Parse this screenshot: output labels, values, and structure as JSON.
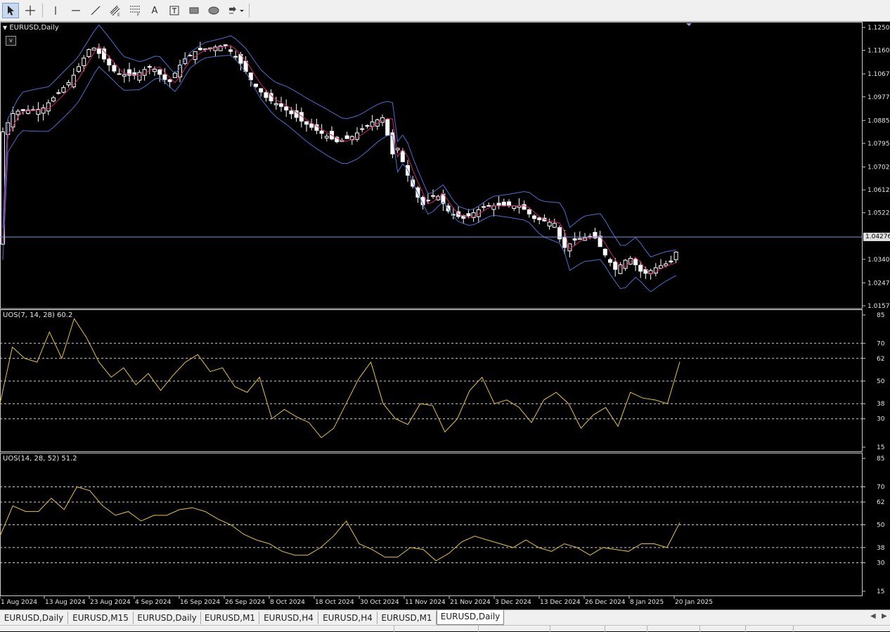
{
  "toolbar": {
    "tools": [
      {
        "icon": "cursor-arrow-icon",
        "active": true
      },
      {
        "icon": "crosshair-icon",
        "active": false
      },
      {
        "icon": "vertical-line-icon",
        "active": false
      },
      {
        "icon": "horizontal-line-icon",
        "active": false
      },
      {
        "icon": "trendline-icon",
        "active": false
      },
      {
        "icon": "equidistant-channel-icon",
        "active": false
      },
      {
        "icon": "fibonacci-retracement-icon",
        "active": false
      },
      {
        "icon": "text-icon",
        "active": false
      },
      {
        "icon": "text-label-icon",
        "active": false
      },
      {
        "icon": "rectangle-icon",
        "active": false
      },
      {
        "icon": "ellipse-icon",
        "active": false
      },
      {
        "icon": "arrow-shapes-dropdown-icon",
        "active": false
      }
    ],
    "text_tool_glyph": "A",
    "text_label_glyph": "T"
  },
  "main_chart": {
    "title": "EURUSD,Daily",
    "sublabel": "v",
    "current_price": "1.04276",
    "price_axis": [
      "1.12500",
      "1.11600",
      "1.10675",
      "1.09775",
      "1.08850",
      "1.07950",
      "1.07025",
      "1.06125",
      "1.05225",
      "1.04276",
      "1.03400",
      "1.02475",
      "1.01575"
    ],
    "colors": {
      "bull": "#ffffff",
      "bear": "#ffffff",
      "bands": "#4a6fd0",
      "mid": "#d0206a",
      "hline": "#7f93d9"
    }
  },
  "indicator1": {
    "title": "UOS(7, 14, 28) 60.2",
    "levels": [
      "85",
      "70",
      "62",
      "50",
      "38",
      "30",
      "15"
    ],
    "color": "#e8c23a"
  },
  "indicator2": {
    "title": "UOS(14, 28, 52) 51.2",
    "levels": [
      "85",
      "70",
      "62",
      "50",
      "38",
      "30",
      "15"
    ],
    "color": "#e8c23a"
  },
  "time_axis": [
    "1 Aug 2024",
    "13 Aug 2024",
    "23 Aug 2024",
    "4 Sep 2024",
    "16 Sep 2024",
    "26 Sep 2024",
    "8 Oct 2024",
    "18 Oct 2024",
    "30 Oct 2024",
    "11 Nov 2024",
    "21 Nov 2024",
    "3 Dec 2024",
    "13 Dec 2024",
    "26 Dec 2024",
    "8 Jan 2025",
    "20 Jan 2025"
  ],
  "chart_data": [
    {
      "type": "candlestick",
      "title": "EURUSD,Daily",
      "ylim": [
        1.01575,
        1.125
      ],
      "x": [
        "1 Aug 2024",
        "13 Aug 2024",
        "23 Aug 2024",
        "4 Sep 2024",
        "16 Sep 2024",
        "26 Sep 2024",
        "8 Oct 2024",
        "18 Oct 2024",
        "30 Oct 2024",
        "11 Nov 2024",
        "21 Nov 2024",
        "3 Dec 2024",
        "13 Dec 2024",
        "26 Dec 2024",
        "8 Jan 2025",
        "20 Jan 2025"
      ],
      "close": [
        1.093,
        1.099,
        1.118,
        1.105,
        1.108,
        1.115,
        1.095,
        1.087,
        1.085,
        1.055,
        1.049,
        1.052,
        1.043,
        1.041,
        1.03,
        1.0428
      ],
      "last_price": 1.04276
    },
    {
      "type": "line",
      "title": "UOS(7, 14, 28) 60.2",
      "ylim": [
        15,
        85
      ],
      "levels": [
        70,
        62,
        50,
        38,
        30
      ],
      "series": [
        {
          "name": "UOS(7, 14, 28)",
          "values": [
            38,
            68,
            62,
            60,
            76,
            62,
            83,
            73,
            60,
            52,
            57,
            48,
            54,
            45,
            53,
            60,
            64,
            55,
            57,
            47,
            44,
            52,
            30,
            35,
            31,
            28,
            20,
            25,
            38,
            51,
            60,
            38,
            30,
            27,
            38,
            37,
            23,
            30,
            45,
            52,
            38,
            40,
            36,
            28,
            40,
            44,
            38,
            25,
            32,
            36,
            26,
            44,
            41,
            40,
            38,
            60.2
          ]
        }
      ],
      "last_value": 60.2
    },
    {
      "type": "line",
      "title": "UOS(14, 28, 52) 51.2",
      "ylim": [
        15,
        85
      ],
      "levels": [
        70,
        62,
        50,
        38,
        30
      ],
      "series": [
        {
          "name": "UOS(14, 28, 52)",
          "values": [
            44,
            60,
            57,
            57,
            64,
            58,
            70,
            68,
            60,
            55,
            57,
            52,
            55,
            55,
            58,
            59,
            57,
            53,
            50,
            45,
            42,
            40,
            36,
            34,
            34,
            38,
            44,
            52,
            40,
            37,
            33,
            33,
            38,
            37,
            31,
            35,
            41,
            44,
            42,
            40,
            38,
            42,
            38,
            36,
            40,
            38,
            34,
            38,
            37,
            36,
            40,
            40,
            38,
            51.2
          ]
        }
      ],
      "last_value": 51.2
    }
  ],
  "tabs": [
    {
      "label": "EURUSD,Daily",
      "active": false
    },
    {
      "label": "EURUSD,M15",
      "active": false
    },
    {
      "label": "EURUSD,Daily",
      "active": false
    },
    {
      "label": "EURUSD,M1",
      "active": false
    },
    {
      "label": "EURUSD,H4",
      "active": false
    },
    {
      "label": "EURUSD,H4",
      "active": false
    },
    {
      "label": "EURUSD,M1",
      "active": false
    },
    {
      "label": "EURUSD,Daily",
      "active": true
    }
  ],
  "tab_scroll": {
    "left": "◀",
    "right": "▶"
  }
}
